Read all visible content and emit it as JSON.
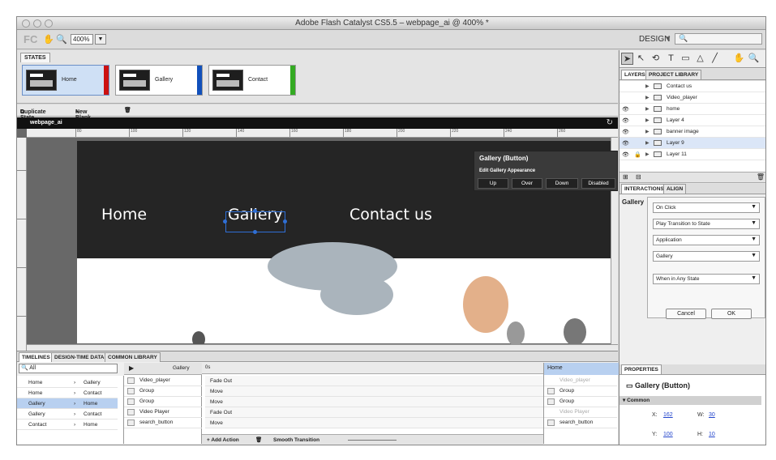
{
  "window": {
    "title": "Adobe Flash Catalyst CS5.5 – webpage_ai @ 400% *"
  },
  "toolbar": {
    "logo": "FC",
    "zoom": "400%",
    "workspace": "DESIGN",
    "search_placeholder": ""
  },
  "states": {
    "tab": "STATES",
    "items": [
      {
        "name": "Home",
        "color": "#cc1111"
      },
      {
        "name": "Gallery",
        "color": "#1150bb"
      },
      {
        "name": "Contact",
        "color": "#33aa22"
      }
    ],
    "duplicate_label": "Duplicate State",
    "new_blank_label": "New Blank State"
  },
  "canvas": {
    "doc_name": "webpage_ai",
    "ruler_ticks": [
      "80",
      "100",
      "120",
      "140",
      "160",
      "180",
      "200",
      "220",
      "240",
      "260"
    ],
    "nav": {
      "home": "Home",
      "gallery": "Gallery",
      "contact": "Contact us"
    }
  },
  "popup": {
    "title": "Gallery (Button)",
    "subtitle": "Edit Gallery Appearance",
    "buttons": [
      "Up",
      "Over",
      "Down",
      "Disabled"
    ]
  },
  "timelines": {
    "tabs": [
      "TIMELINES",
      "DESIGN-TIME DATA",
      "COMMON LIBRARY"
    ],
    "filter": "All",
    "transitions": [
      {
        "from": "Home",
        "to": "Gallery"
      },
      {
        "from": "Home",
        "to": "Contact"
      },
      {
        "from": "Gallery",
        "to": "Home"
      },
      {
        "from": "Gallery",
        "to": "Contact"
      },
      {
        "from": "Contact",
        "to": "Home"
      }
    ],
    "start_state": "Gallery",
    "end_state": "Home",
    "time_start": "0s",
    "objects": [
      "Video_player",
      "Group",
      "Group",
      "Video Player",
      "search_button"
    ],
    "actions": [
      "Fade Out",
      "Move",
      "Move",
      "Fade Out",
      "Move"
    ],
    "end_objects": [
      "Video_player",
      "Group",
      "Group",
      "Video Player",
      "search_button"
    ],
    "add_action": "+ Add Action",
    "smooth": "Smooth Transition"
  },
  "library": {
    "tabs": [
      "LAYERS",
      "PROJECT LIBRARY"
    ],
    "layers": [
      "Contact us",
      "Video_player",
      "home",
      "Layer 4",
      "banner image",
      "Layer 9",
      "Layer 11"
    ]
  },
  "interactions": {
    "tabs": [
      "INTERACTIONS",
      "ALIGN"
    ],
    "label": "Gallery",
    "selects": [
      "On Click",
      "Play Transition to State",
      "Application",
      "Gallery",
      "When in Any State"
    ],
    "cancel": "Cancel",
    "ok": "OK"
  },
  "properties": {
    "tab": "PROPERTIES",
    "title": "Gallery (Button)",
    "section": "Common",
    "x_label": "X:",
    "x": "162",
    "w_label": "W:",
    "w": "30",
    "y_label": "Y:",
    "y": "100",
    "h_label": "H:",
    "h": "10"
  }
}
